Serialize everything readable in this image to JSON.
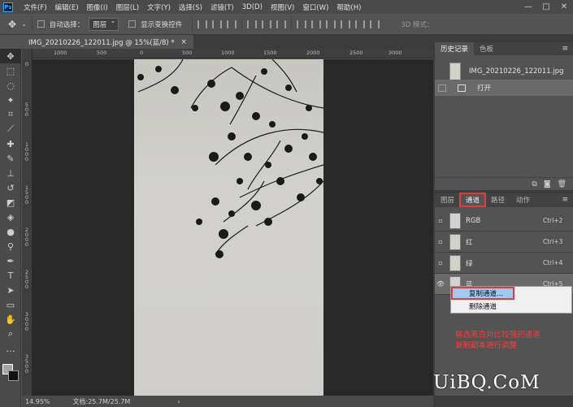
{
  "menubar": {
    "logo": "Ps",
    "items": [
      "文件(F)",
      "编辑(E)",
      "图像(I)",
      "图层(L)",
      "文字(Y)",
      "选择(S)",
      "滤镜(T)",
      "3D(D)",
      "视图(V)",
      "窗口(W)",
      "帮助(H)"
    ],
    "window_buttons": [
      "—",
      "□",
      "✕"
    ]
  },
  "options": {
    "auto_select_label": "自动选择：",
    "auto_select_value": "图层",
    "show_transform_label": "显示变换控件",
    "mode_3d_label": "3D 模式："
  },
  "document": {
    "tab_title": "IMG_20210226_122011.jpg @ 15%(蓝/8) *",
    "tab_close": "×"
  },
  "ruler": {
    "top_ticks": [
      "1000",
      "500",
      "0",
      "500",
      "1000",
      "1500",
      "2000",
      "2500",
      "3000"
    ],
    "left_ticks": [
      "0",
      "5\n0\n0",
      "1\n0\n0\n0",
      "1\n5\n0\n0",
      "2\n0\n0\n0",
      "2\n5\n0\n0",
      "3\n0\n0\n0",
      "3\n5\n0\n0"
    ]
  },
  "status": {
    "zoom": "14.95%",
    "doc_size": "文档:25.7M/25.7M",
    "arrow": "›"
  },
  "history_panel": {
    "tabs": [
      "历史记录",
      "色板"
    ],
    "snapshot_name": "IMG_20210226_122011.jpg",
    "step": "打开"
  },
  "channels_panel": {
    "tabs": [
      "图层",
      "通道",
      "路径",
      "动作"
    ],
    "channels": [
      {
        "name": "RGB",
        "shortcut": "Ctrl+2"
      },
      {
        "name": "红",
        "shortcut": "Ctrl+3"
      },
      {
        "name": "绿",
        "shortcut": "Ctrl+4"
      },
      {
        "name": "蓝",
        "shortcut": "Ctrl+5"
      }
    ]
  },
  "context_menu": {
    "items": [
      "复制通道...",
      "删除通道"
    ]
  },
  "annotation": {
    "line1": "挑选黑白对比较强的通道",
    "line2": "复制副本进行调整"
  },
  "watermark": "UiBQ.CoM",
  "colors": {
    "accent_red": "#e23b3b",
    "highlight_blue": "#9fcbf3"
  }
}
